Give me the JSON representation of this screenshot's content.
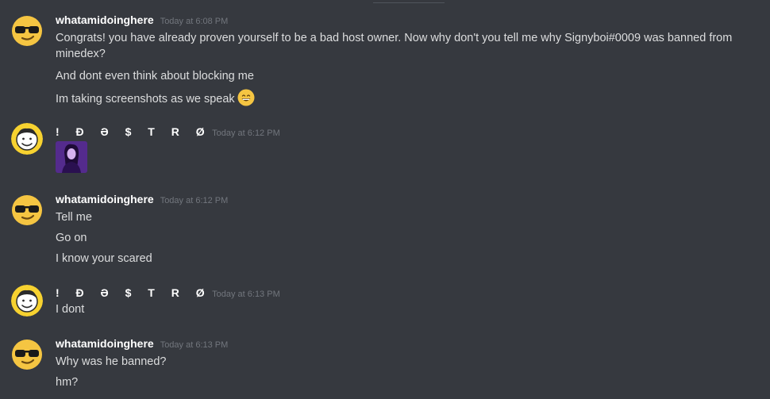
{
  "colors": {
    "background": "#36393f",
    "username": "#ffffff",
    "message_text": "#dcddde",
    "timestamp": "#72767d"
  },
  "messages": [
    {
      "author": "whatamidoinghere",
      "avatar": "sunglasses-emoji-avatar",
      "timestamp": "Today at 6:08 PM",
      "lines": [
        "Congrats! you have already proven yourself to be a bad host owner. Now why don't you tell me why Signyboi#0009 was banned from minedex?",
        "And dont even think about blocking me",
        "Im taking screenshots as we speak"
      ],
      "emoji": "grinning-face-emoji"
    },
    {
      "author": "!     Ð Ə $ T R Ø",
      "avatar": "smiling-face-avatar",
      "timestamp": "Today at 6:12 PM",
      "attachment": "purple-photo-thumbnail"
    },
    {
      "author": "whatamidoinghere",
      "avatar": "sunglasses-emoji-avatar",
      "timestamp": "Today at 6:12 PM",
      "lines": [
        "Tell me",
        "Go on",
        "I know your scared"
      ]
    },
    {
      "author": "!     Ð Ə $ T R Ø",
      "avatar": "smiling-face-avatar",
      "timestamp": "Today at 6:13 PM",
      "lines": [
        "I dont"
      ]
    },
    {
      "author": "whatamidoinghere",
      "avatar": "sunglasses-emoji-avatar",
      "timestamp": "Today at 6:13 PM",
      "lines": [
        "Why was he banned?",
        "hm?"
      ]
    }
  ]
}
